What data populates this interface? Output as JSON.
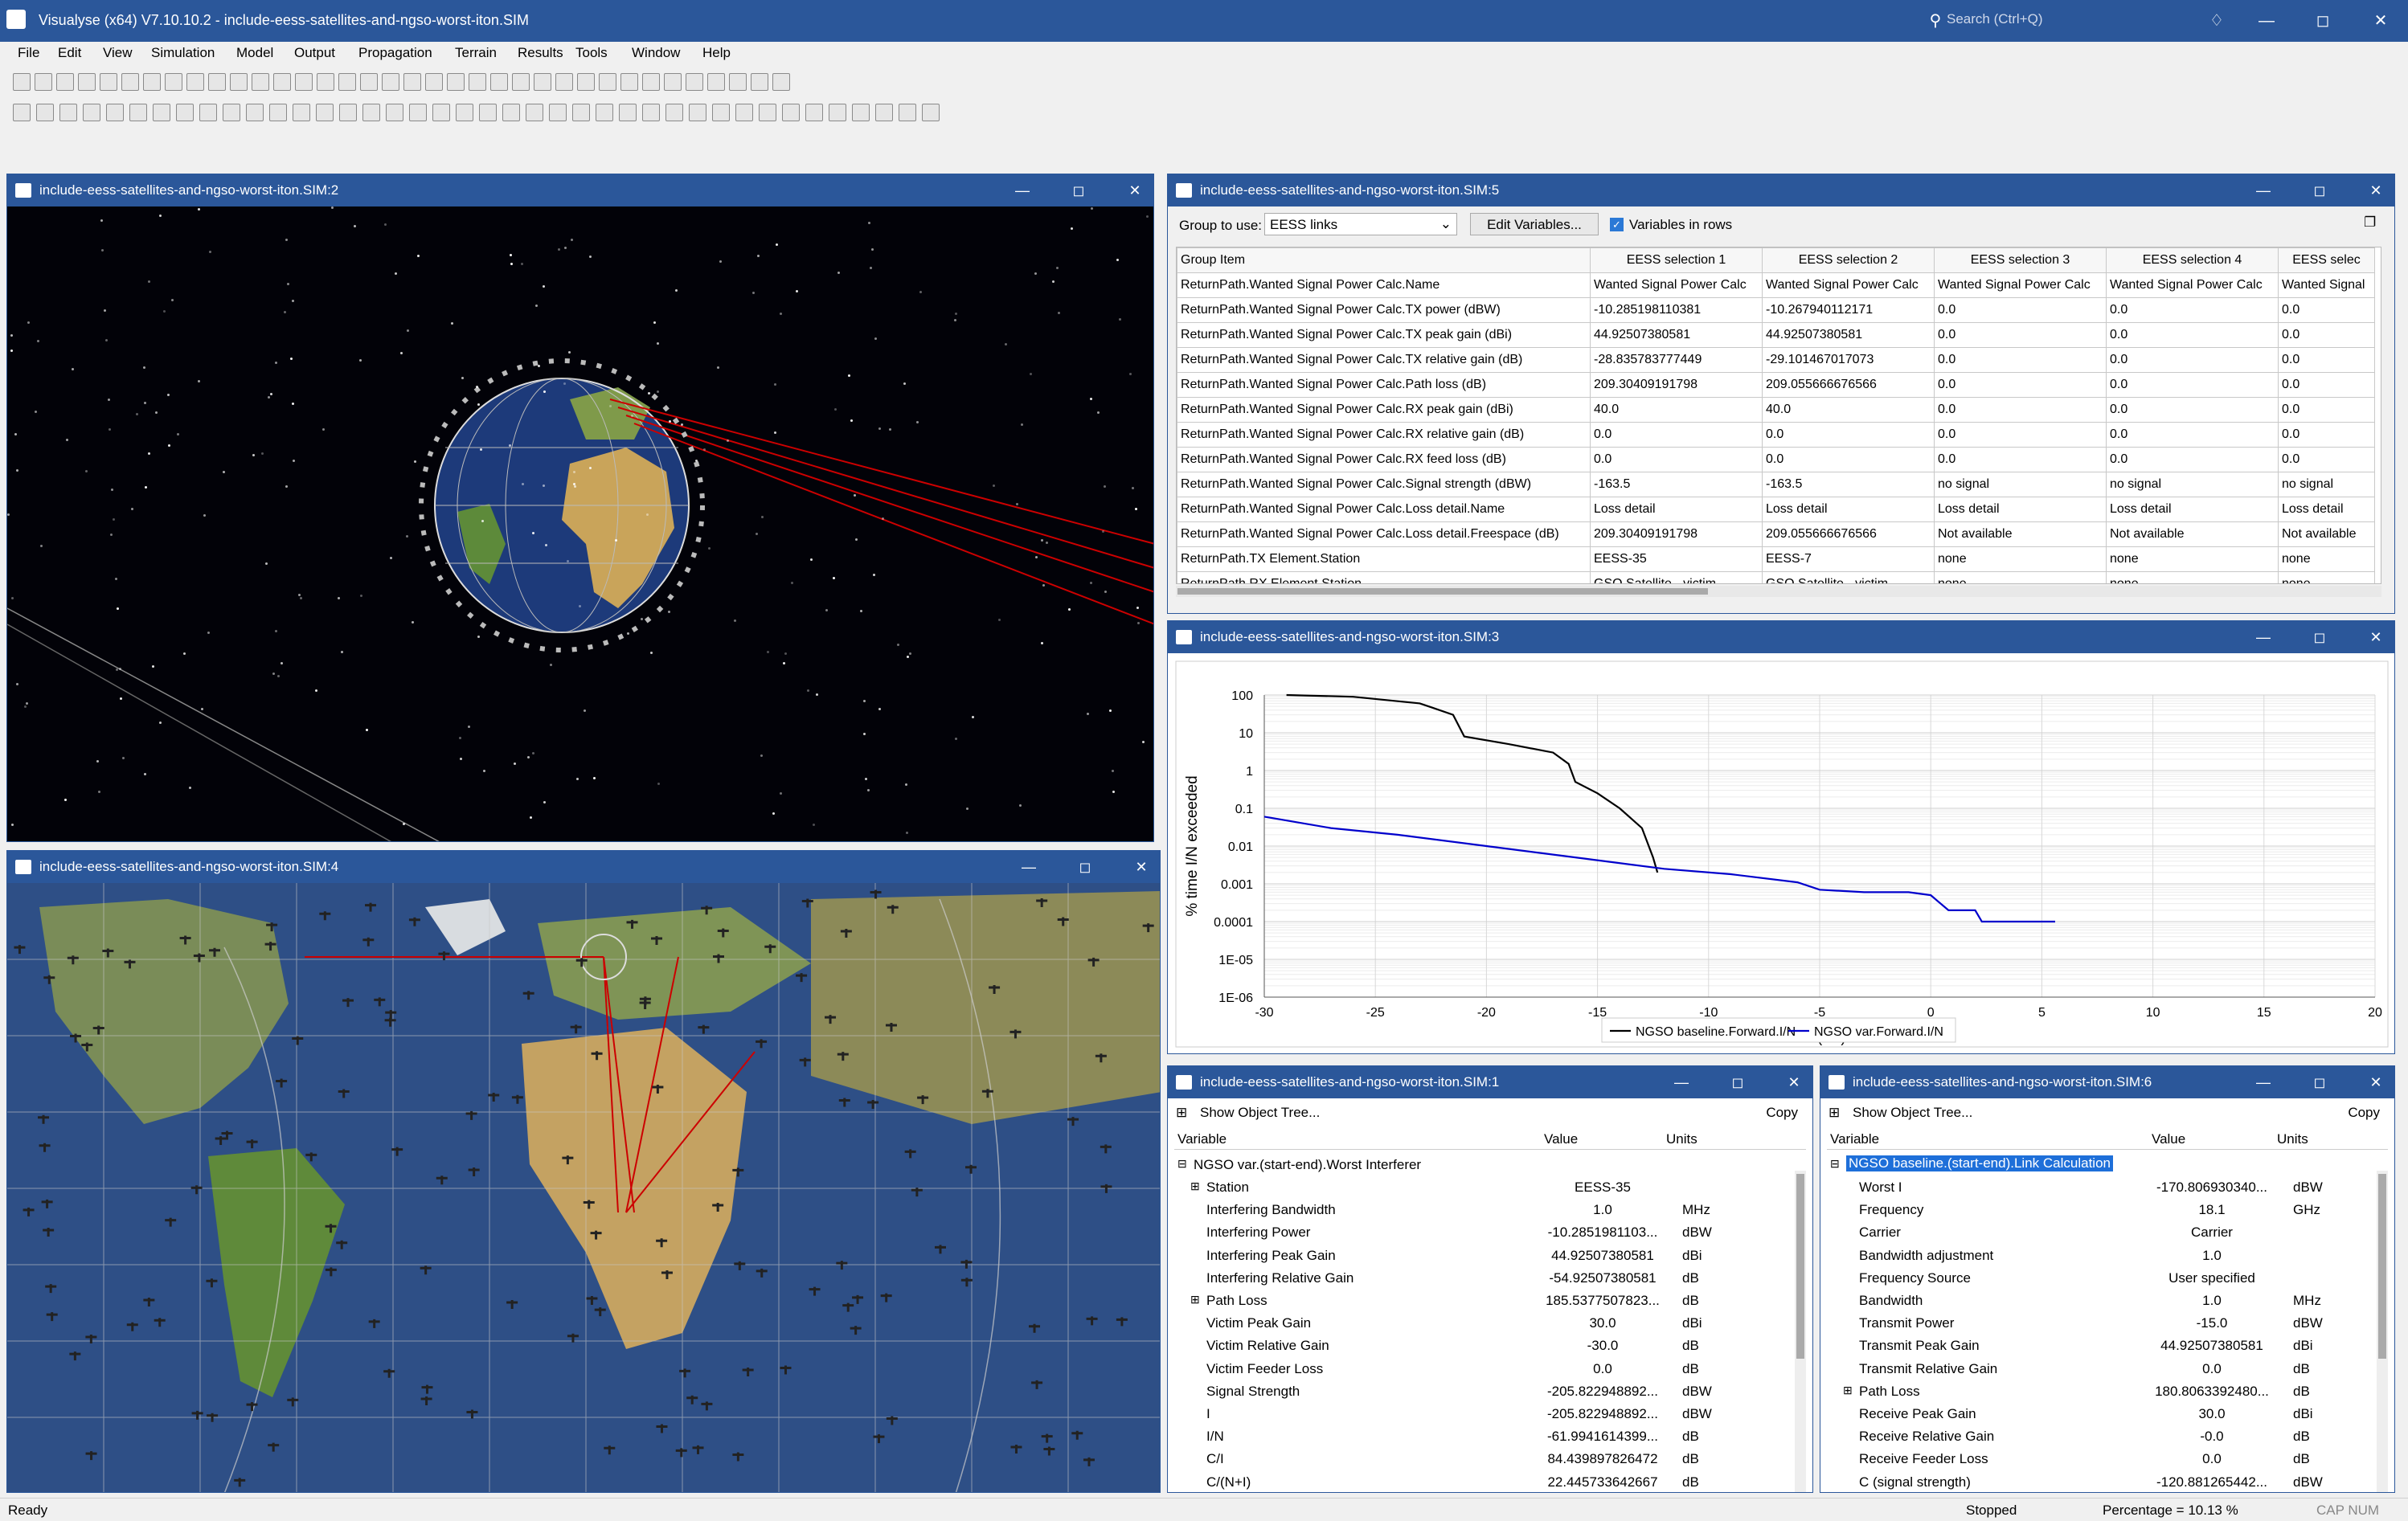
{
  "app": {
    "title": "Visualyse (x64) V7.10.10.2 - include-eess-satellites-and-ngso-worst-iton.SIM",
    "search_placeholder": "Search (Ctrl+Q)"
  },
  "menu": [
    "File",
    "Edit",
    "View",
    "Simulation",
    "Model",
    "Output",
    "Propagation",
    "Terrain",
    "Results",
    "Tools",
    "Window",
    "Help"
  ],
  "windows": {
    "w2": "include-eess-satellites-and-ngso-worst-iton.SIM:2",
    "w5": "include-eess-satellites-and-ngso-worst-iton.SIM:5",
    "w4": "include-eess-satellites-and-ngso-worst-iton.SIM:4",
    "w3": "include-eess-satellites-and-ngso-worst-iton.SIM:3",
    "w1": "include-eess-satellites-and-ngso-worst-iton.SIM:1",
    "w6": "include-eess-satellites-and-ngso-worst-iton.SIM:6"
  },
  "table5": {
    "group_label": "Group to use:",
    "group_value": "EESS links",
    "edit_button": "Edit Variables...",
    "rows_checkbox": "Variables in rows",
    "headers": [
      "Group Item",
      "EESS selection 1",
      "EESS selection 2",
      "EESS selection 3",
      "EESS selection 4",
      "EESS selec"
    ],
    "rows": [
      [
        "ReturnPath.Wanted Signal Power Calc.Name",
        "Wanted Signal Power Calc",
        "Wanted Signal Power Calc",
        "Wanted Signal Power Calc",
        "Wanted Signal Power Calc",
        "Wanted Signal"
      ],
      [
        "ReturnPath.Wanted Signal Power Calc.TX power (dBW)",
        "-10.285198110381",
        "-10.267940112171",
        "0.0",
        "0.0",
        "0.0"
      ],
      [
        "ReturnPath.Wanted Signal Power Calc.TX peak gain (dBi)",
        "44.92507380581",
        "44.92507380581",
        "0.0",
        "0.0",
        "0.0"
      ],
      [
        "ReturnPath.Wanted Signal Power Calc.TX relative gain (dB)",
        "-28.835783777449",
        "-29.101467017073",
        "0.0",
        "0.0",
        "0.0"
      ],
      [
        "ReturnPath.Wanted Signal Power Calc.Path loss (dB)",
        "209.30409191798",
        "209.055666676566",
        "0.0",
        "0.0",
        "0.0"
      ],
      [
        "ReturnPath.Wanted Signal Power Calc.RX peak gain (dBi)",
        "40.0",
        "40.0",
        "0.0",
        "0.0",
        "0.0"
      ],
      [
        "ReturnPath.Wanted Signal Power Calc.RX relative gain (dB)",
        "0.0",
        "0.0",
        "0.0",
        "0.0",
        "0.0"
      ],
      [
        "ReturnPath.Wanted Signal Power Calc.RX feed loss (dB)",
        "0.0",
        "0.0",
        "0.0",
        "0.0",
        "0.0"
      ],
      [
        "ReturnPath.Wanted Signal Power Calc.Signal strength (dBW)",
        "-163.5",
        "-163.5",
        "no signal",
        "no signal",
        "no signal"
      ],
      [
        "ReturnPath.Wanted Signal Power Calc.Loss detail.Name",
        "Loss detail",
        "Loss detail",
        "Loss detail",
        "Loss detail",
        "Loss detail"
      ],
      [
        "ReturnPath.Wanted Signal Power Calc.Loss detail.Freespace (dB)",
        "209.30409191798",
        "209.055666676566",
        "Not available",
        "Not available",
        "Not available"
      ],
      [
        "ReturnPath.TX Element.Station",
        "EESS-35",
        "EESS-7",
        "none",
        "none",
        "none"
      ],
      [
        "ReturnPath.RX Element.Station",
        "GSO Satellite - victim",
        "GSO Satellite - victim",
        "none",
        "none",
        "none"
      ]
    ]
  },
  "chart_data": {
    "type": "line",
    "title": "",
    "xlabel": "I/N (dB)",
    "ylabel": "% time I/N exceeded",
    "xlim": [
      -30,
      20
    ],
    "ylim": [
      1e-06,
      100
    ],
    "yscale": "log",
    "xticks": [
      "-30",
      "-25",
      "-20",
      "-15",
      "-10",
      "-5",
      "0",
      "5",
      "10",
      "15",
      "20"
    ],
    "yticks": [
      "100",
      "10",
      "1",
      "0.1",
      "0.01",
      "0.001",
      "0.0001",
      "1E-05",
      "1E-06"
    ],
    "grid": true,
    "legend_position": "bottom",
    "series": [
      {
        "name": "NGSO baseline.Forward.I/N",
        "color": "#000000",
        "points": [
          [
            -29,
            100
          ],
          [
            -26,
            90
          ],
          [
            -23,
            60
          ],
          [
            -21.5,
            30
          ],
          [
            -21,
            8
          ],
          [
            -19,
            5
          ],
          [
            -17,
            3
          ],
          [
            -16.3,
            1.5
          ],
          [
            -16,
            0.5
          ],
          [
            -15,
            0.25
          ],
          [
            -14,
            0.1
          ],
          [
            -13,
            0.03
          ],
          [
            -12.5,
            0.005
          ],
          [
            -12.3,
            0.002
          ]
        ]
      },
      {
        "name": "NGSO var.Forward.I/N",
        "color": "#0000cc",
        "points": [
          [
            -30,
            0.06
          ],
          [
            -27,
            0.03
          ],
          [
            -24,
            0.02
          ],
          [
            -20,
            0.01
          ],
          [
            -16,
            0.005
          ],
          [
            -12,
            0.0025
          ],
          [
            -9,
            0.0018
          ],
          [
            -6,
            0.0011
          ],
          [
            -5,
            0.0007
          ],
          [
            -3,
            0.0006
          ],
          [
            -1,
            0.0006
          ],
          [
            0,
            0.0005
          ],
          [
            0.8,
            0.0002
          ],
          [
            2,
            0.0002
          ],
          [
            2.3,
            0.0001
          ],
          [
            5.6,
            0.0001
          ]
        ]
      }
    ]
  },
  "tree1": {
    "show_tree": "Show Object Tree...",
    "copy": "Copy",
    "headers": [
      "Variable",
      "Value",
      "Units"
    ],
    "root": "NGSO var.(start-end).Worst Interferer",
    "rows": [
      {
        "name": "Station",
        "value": "EESS-35",
        "units": "",
        "expand": true
      },
      {
        "name": "Interfering Bandwidth",
        "value": "1.0",
        "units": "MHz"
      },
      {
        "name": "Interfering Power",
        "value": "-10.2851981103...",
        "units": "dBW"
      },
      {
        "name": "Interfering Peak Gain",
        "value": "44.92507380581",
        "units": "dBi"
      },
      {
        "name": "Interfering Relative Gain",
        "value": "-54.92507380581",
        "units": "dB"
      },
      {
        "name": "Path Loss",
        "value": "185.5377507823...",
        "units": "dB",
        "expand": true
      },
      {
        "name": "Victim Peak Gain",
        "value": "30.0",
        "units": "dBi"
      },
      {
        "name": "Victim Relative Gain",
        "value": "-30.0",
        "units": "dB"
      },
      {
        "name": "Victim Feeder Loss",
        "value": "0.0",
        "units": "dB"
      },
      {
        "name": "Signal Strength",
        "value": "-205.822948892...",
        "units": "dBW"
      },
      {
        "name": "I",
        "value": "-205.822948892...",
        "units": "dBW"
      },
      {
        "name": "I/N",
        "value": "-61.9941614399...",
        "units": "dB"
      },
      {
        "name": "C/I",
        "value": "84.439897826472",
        "units": "dB"
      },
      {
        "name": "C/(N+I)",
        "value": "22.445733642667",
        "units": "dB"
      }
    ]
  },
  "tree6": {
    "show_tree": "Show Object Tree...",
    "copy": "Copy",
    "headers": [
      "Variable",
      "Value",
      "Units"
    ],
    "root": "NGSO baseline.(start-end).Link Calculation",
    "rows": [
      {
        "name": "Worst I",
        "value": "-170.806930340...",
        "units": "dBW"
      },
      {
        "name": "Frequency",
        "value": "18.1",
        "units": "GHz"
      },
      {
        "name": "Carrier",
        "value": "Carrier",
        "units": ""
      },
      {
        "name": "Bandwidth adjustment",
        "value": "1.0",
        "units": ""
      },
      {
        "name": "Frequency Source",
        "value": "User specified",
        "units": ""
      },
      {
        "name": "Bandwidth",
        "value": "1.0",
        "units": "MHz"
      },
      {
        "name": "Transmit Power",
        "value": "-15.0",
        "units": "dBW"
      },
      {
        "name": "Transmit Peak Gain",
        "value": "44.92507380581",
        "units": "dBi"
      },
      {
        "name": "Transmit Relative Gain",
        "value": "0.0",
        "units": "dB"
      },
      {
        "name": "Path Loss",
        "value": "180.8063392480...",
        "units": "dB",
        "expand": true
      },
      {
        "name": "Receive Peak Gain",
        "value": "30.0",
        "units": "dBi"
      },
      {
        "name": "Receive Relative Gain",
        "value": "-0.0",
        "units": "dB"
      },
      {
        "name": "Receive Feeder Loss",
        "value": "0.0",
        "units": "dB"
      },
      {
        "name": "C (signal strength)",
        "value": "-120.881265442...",
        "units": "dBW"
      }
    ]
  },
  "status": {
    "left": "Ready",
    "state": "Stopped",
    "percentage": "Percentage = 10.13 %",
    "keys": "CAP NUM"
  }
}
